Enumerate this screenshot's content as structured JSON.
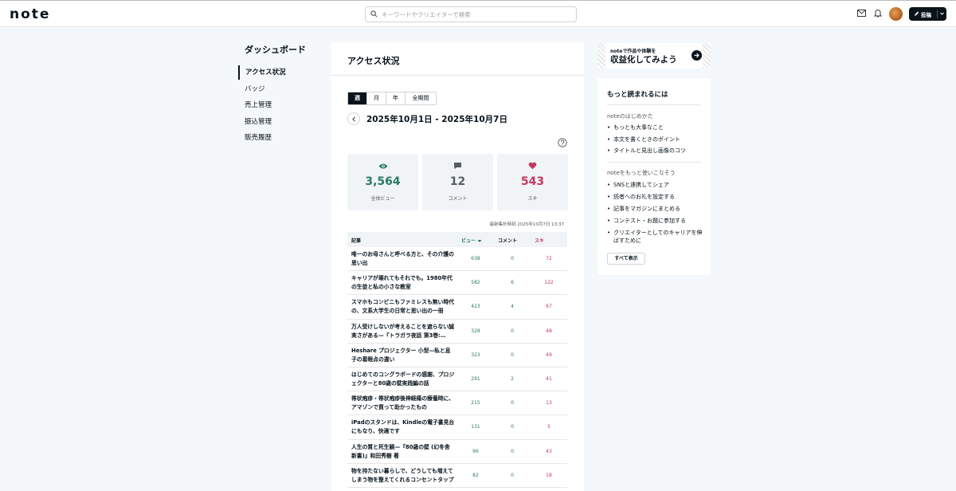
{
  "header": {
    "logo": "note",
    "search_placeholder": "キーワードやクリエイターで検索",
    "post_label": "投稿"
  },
  "sidebar": {
    "title": "ダッシュボード",
    "items": [
      {
        "label": "アクセス状況",
        "active": true
      },
      {
        "label": "バッジ"
      },
      {
        "label": "売上管理"
      },
      {
        "label": "振込管理"
      },
      {
        "label": "販売履歴"
      }
    ]
  },
  "main": {
    "title": "アクセス状況",
    "period_tabs": [
      "週",
      "月",
      "年",
      "全期間"
    ],
    "selected_period": "週",
    "date_range": "2025年10月1日 - 2025年10月7日",
    "stats": [
      {
        "value": "3,564",
        "label": "全体ビュー",
        "color": "#2b7a5f"
      },
      {
        "value": "12",
        "label": "コメント",
        "color": "#555e64"
      },
      {
        "value": "543",
        "label": "スキ",
        "color": "#c4385e"
      }
    ],
    "updated_at": "最新集計時刻 2025年10月7日 13:37",
    "table": {
      "headers": {
        "article": "記事",
        "views": "ビュー",
        "comments": "コメント",
        "likes": "スキ"
      },
      "rows": [
        {
          "title": "唯一のお母さんと呼べる方と、その介護の思い出",
          "views": "638",
          "comments": "0",
          "likes": "72"
        },
        {
          "title": "キャリアが壊れてもそれでも。1980年代の生徒と私の小さな教室",
          "views": "582",
          "comments": "6",
          "likes": "122"
        },
        {
          "title": "スマホもコンビニもファミレスも無い時代の、文系大学生の日常と思い出の一冊",
          "views": "423",
          "comments": "4",
          "likes": "67"
        },
        {
          "title": "万人受けしないが考えることを遮らない誠実さがある—『トラガラ夜話 第3巻:…",
          "views": "328",
          "comments": "0",
          "likes": "48"
        },
        {
          "title": "Heshare プロジェクター 小型—私と息子の着眼点の違い",
          "views": "323",
          "comments": "0",
          "likes": "49"
        },
        {
          "title": "はじめてのコングラボードの感謝、プロジェクターと80歳の壁実践編の話",
          "views": "291",
          "comments": "2",
          "likes": "41"
        },
        {
          "title": "帯状疱疹・帯状疱疹後神経痛の療養時に、アマゾンで買って助かったもの",
          "views": "215",
          "comments": "0",
          "likes": "13"
        },
        {
          "title": "iPadのスタンドは、Kindleの電子書見台にもなり、快適です",
          "views": "131",
          "comments": "0",
          "likes": "5"
        },
        {
          "title": "人生の質と死生観—『80歳の壁 (幻冬舎新書)』和田秀樹 著",
          "views": "96",
          "comments": "0",
          "likes": "43"
        },
        {
          "title": "物を持たない暮らしで、どうしても増えてしまう物を整えてくれるコンセントタップ",
          "views": "82",
          "comments": "0",
          "likes": "18"
        }
      ]
    }
  },
  "aside": {
    "banner_small": "noteで作品や体験を",
    "banner_big": "収益化してみよう",
    "tips_title": "もっと読まれるには",
    "group1_title": "noteのはじめかた",
    "group1_items": [
      "もっとも大事なこと",
      "本文を書くときのポイント",
      "タイトルと見出し画像のコツ"
    ],
    "group2_title": "noteをもっと使いこなそう",
    "group2_items": [
      "SNSと連携してシェア",
      "読者へのお礼を設定する",
      "記事をマガジンにまとめる",
      "コンテスト・お題に参加する",
      "クリエイターとしてのキャリアを伸ばすために"
    ],
    "more_label": "すべて表示"
  }
}
